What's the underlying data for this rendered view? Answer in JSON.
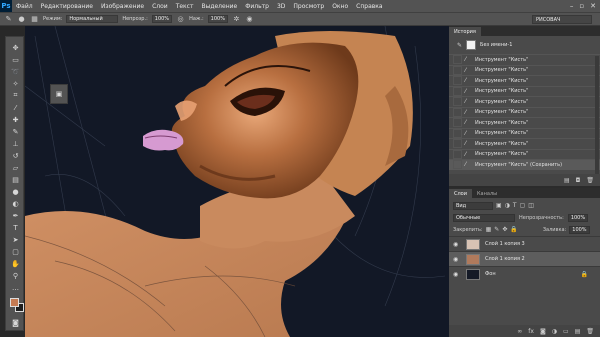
{
  "app": {
    "logo": "Ps"
  },
  "menu": [
    "Файл",
    "Редактирование",
    "Изображение",
    "Слои",
    "Текст",
    "Выделение",
    "Фильтр",
    "3D",
    "Просмотр",
    "Окно",
    "Справка"
  ],
  "window_controls": {
    "minimize": "–",
    "restore": "▫",
    "close": "✕"
  },
  "options": {
    "mode_label": "Режим:",
    "mode_value": "Нормальный",
    "opacity_label": "Непрозр.:",
    "opacity_value": "100%",
    "flow_label": "Наж.:",
    "flow_value": "100%",
    "workspace": "РИСОВАЧ"
  },
  "history": {
    "tab_label": "История",
    "snapshot_label": "Без имени-1",
    "items": [
      "Инструмент \"Кисть\"",
      "Инструмент \"Кисть\"",
      "Инструмент \"Кисть\"",
      "Инструмент \"Кисть\"",
      "Инструмент \"Кисть\"",
      "Инструмент \"Кисть\"",
      "Инструмент \"Кисть\"",
      "Инструмент \"Кисть\"",
      "Инструмент \"Кисть\"",
      "Инструмент \"Кисть\"",
      "Инструмент \"Кисть\" (Сохранить)"
    ]
  },
  "layers_panel": {
    "tab_layers": "Слои",
    "tab_channels": "Каналы",
    "filter_label": "Вид",
    "blend_mode": "Обычные",
    "opacity_label": "Непрозрачность:",
    "opacity_value": "100%",
    "lock_label": "Закрепить:",
    "fill_label": "Заливка:",
    "fill_value": "100%",
    "layers": [
      {
        "name": "Слой 1 копия 3",
        "thumb_color": "#d8c3b4",
        "selected": false,
        "locked": false
      },
      {
        "name": "Слой 1 копия 2",
        "thumb_color": "#b07a5c",
        "selected": true,
        "locked": false
      },
      {
        "name": "Фон",
        "thumb_color": "#151a26",
        "selected": false,
        "locked": true
      }
    ]
  },
  "colors": {
    "canvas_bg": "#121826",
    "skin": "#c47a52",
    "foreground_swatch": "#c47a52",
    "background_swatch": "#1e1e1e",
    "accent": "#31a8ff"
  },
  "icons": {
    "brush": "brush-icon",
    "move": "move-icon",
    "eye": "eye-icon",
    "lock": "lock-icon"
  }
}
